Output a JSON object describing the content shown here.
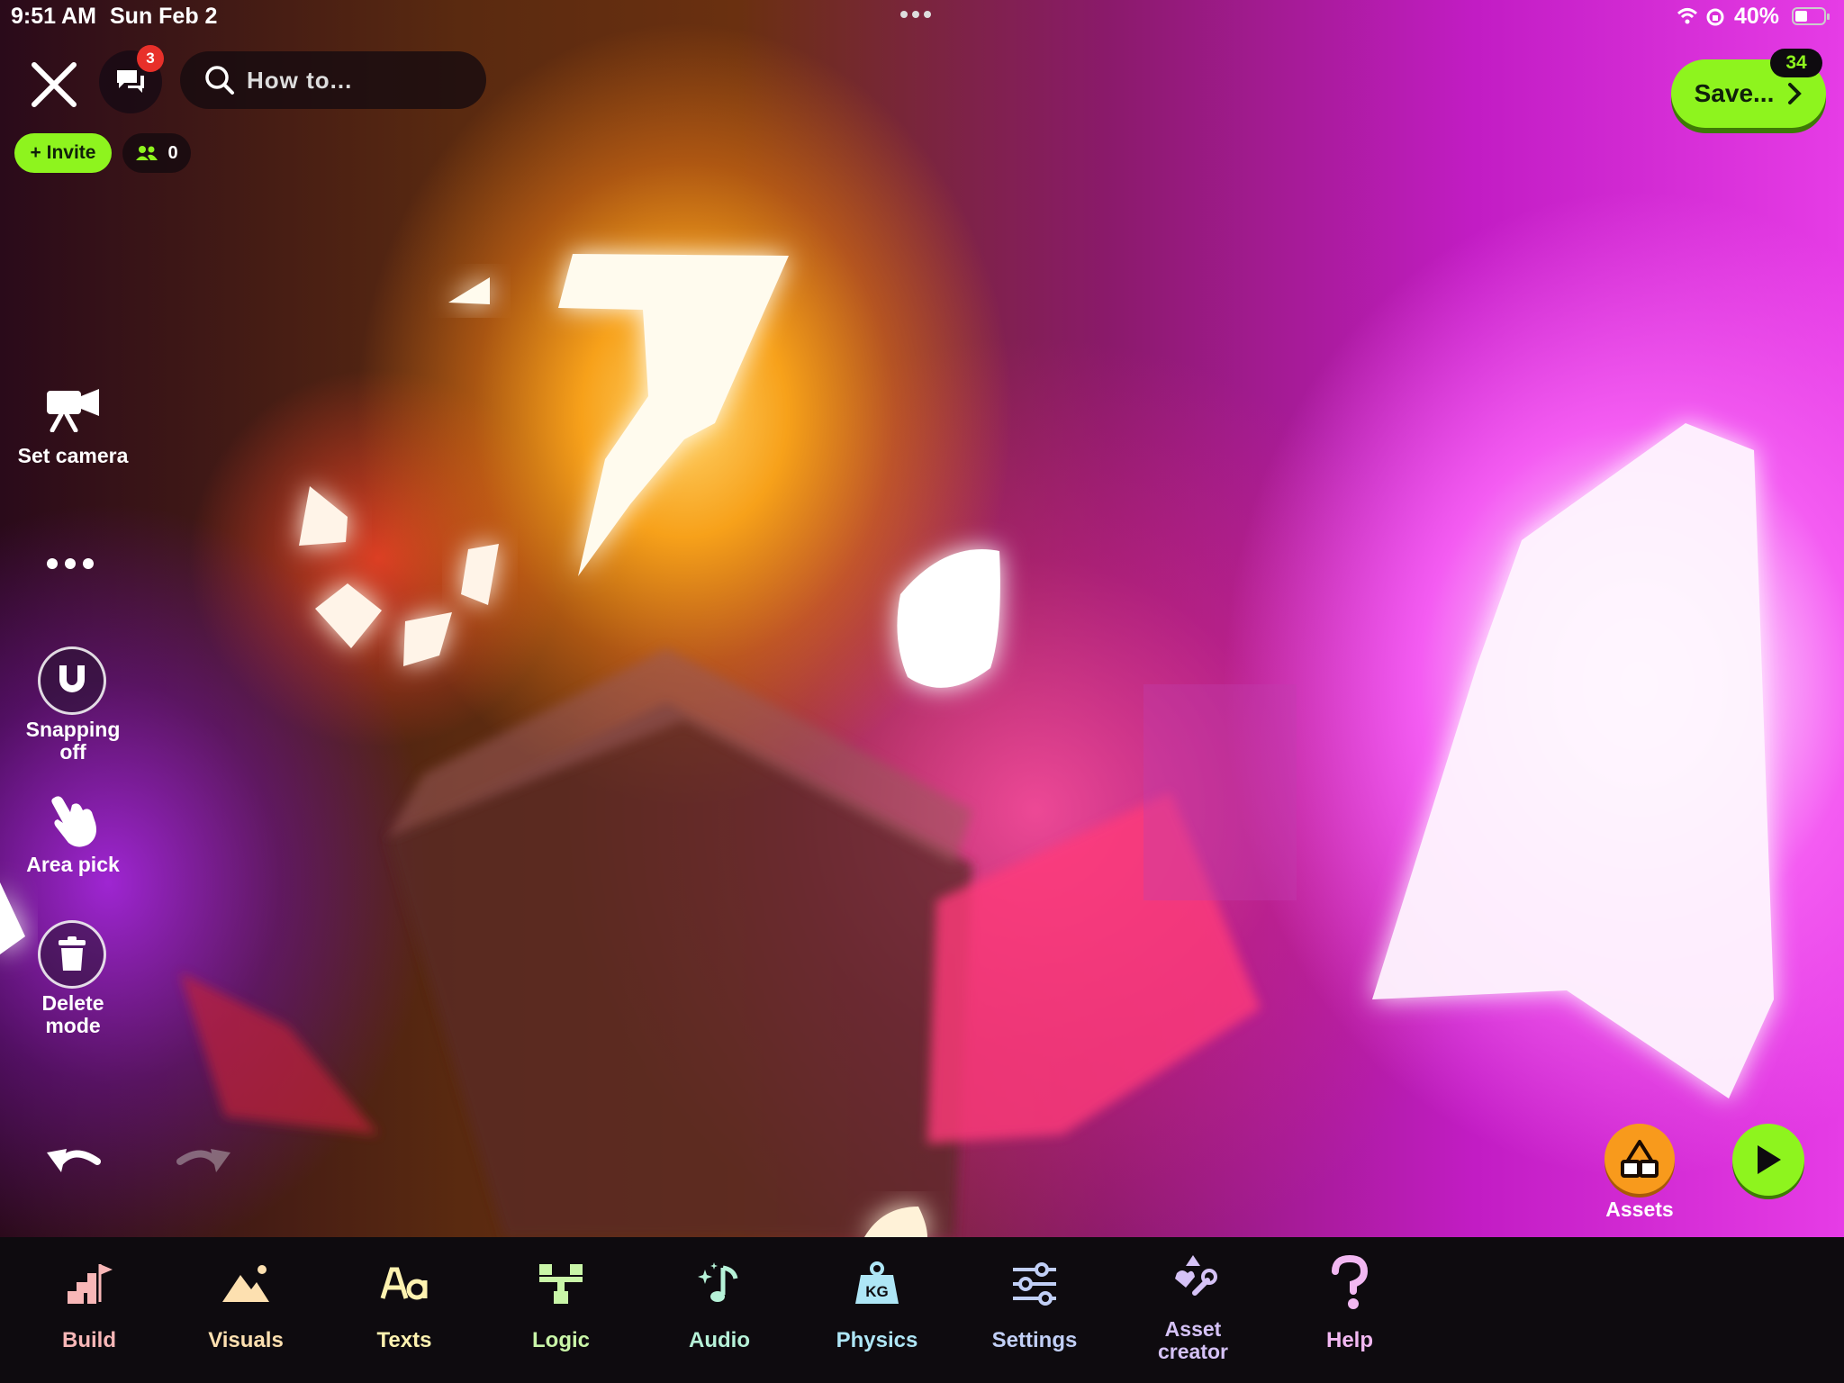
{
  "status_bar": {
    "time": "9:51 AM",
    "date": "Sun Feb 2",
    "battery": "40%"
  },
  "header": {
    "chat_badge": "3",
    "search_placeholder": "How to...",
    "invite_label": "+ Invite",
    "players_count": "0",
    "save_label": "Save...",
    "save_badge": "34"
  },
  "left_tools": {
    "set_camera": "Set camera",
    "snapping_line1": "Snapping",
    "snapping_line2": "off",
    "area_pick": "Area pick",
    "delete_line1": "Delete",
    "delete_line2": "mode"
  },
  "right_tools": {
    "assets_label": "Assets"
  },
  "tabs": [
    {
      "label": "Build",
      "color": "#f8b7b7",
      "icon": "build-icon"
    },
    {
      "label": "Visuals",
      "color": "#fde0b0",
      "icon": "mountains-icon"
    },
    {
      "label": "Texts",
      "color": "#fdf2b0",
      "icon": "font-aa-icon"
    },
    {
      "label": "Logic",
      "color": "#c9f6a8",
      "icon": "logic-tree-icon"
    },
    {
      "label": "Audio",
      "color": "#b6f2d8",
      "icon": "music-sparkle-icon"
    },
    {
      "label": "Physics",
      "color": "#aee6f6",
      "icon": "weight-kg-icon"
    },
    {
      "label": "Settings",
      "color": "#c1cff6",
      "icon": "sliders-icon"
    },
    {
      "label_line1": "Asset",
      "label_line2": "creator",
      "color": "#d5c2f6",
      "icon": "asset-creator-icon"
    },
    {
      "label": "Help",
      "color": "#f2b8f2",
      "icon": "question-icon"
    }
  ],
  "colors": {
    "accent_green": "#8ef41e",
    "badge_red": "#e8302a",
    "assets_orange": "#f89a1c"
  }
}
